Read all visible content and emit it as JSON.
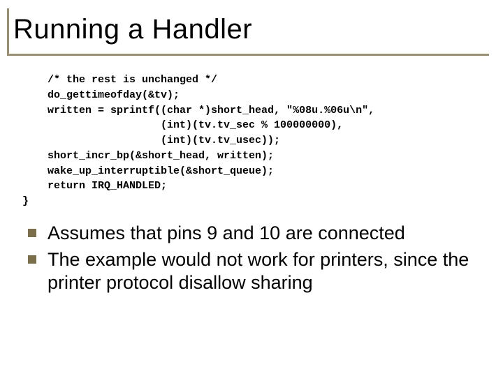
{
  "title": "Running a Handler",
  "code": {
    "l1": "    /* the rest is unchanged */",
    "l2": "    do_gettimeofday(&tv);",
    "l3": "    written = sprintf((char *)short_head, \"%08u.%06u\\n\",",
    "l4": "                      (int)(tv.tv_sec % 100000000),",
    "l5": "                      (int)(tv.tv_usec));",
    "l6": "    short_incr_bp(&short_head, written);",
    "l7": "    wake_up_interruptible(&short_queue);",
    "l8": "    return IRQ_HANDLED;",
    "l9": "}"
  },
  "bullets": [
    "Assumes that pins 9 and 10 are connected",
    "The example would not work for printers, since the printer protocol disallow sharing"
  ]
}
